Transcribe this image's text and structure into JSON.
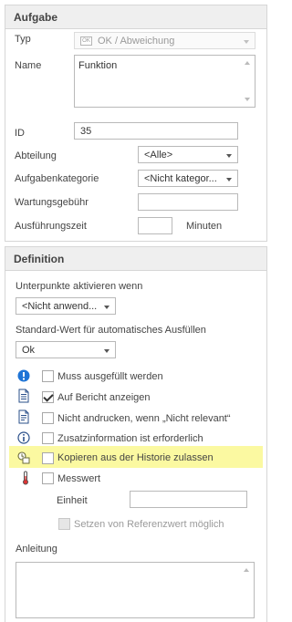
{
  "aufgabe": {
    "header": "Aufgabe",
    "typ_label": "Typ",
    "typ_value": "OK / Abweichung",
    "typ_badge": "OK",
    "name_label": "Name",
    "name_value": "Funktion",
    "id_label": "ID",
    "id_value": "35",
    "abteilung_label": "Abteilung",
    "abteilung_value": "<Alle>",
    "kategorie_label": "Aufgabenkategorie",
    "kategorie_value": "<Nicht kategor...",
    "gebuehr_label": "Wartungsgebühr",
    "gebuehr_value": "",
    "zeit_label": "Ausführungszeit",
    "zeit_value": "",
    "zeit_unit": "Minuten"
  },
  "definition": {
    "header": "Definition",
    "unterpunkte_label": "Unterpunkte aktivieren wenn",
    "unterpunkte_value": "<Nicht anwend...",
    "standard_label": "Standard-Wert für automatisches Ausfüllen",
    "standard_value": "Ok",
    "options": [
      {
        "label": "Muss ausgefüllt werden",
        "checked": false,
        "icon": "required-info-icon"
      },
      {
        "label": "Auf Bericht anzeigen",
        "checked": true,
        "icon": "report-icon"
      },
      {
        "label": "Nicht andrucken, wenn „Nicht relevant“",
        "checked": false,
        "icon": "no-print-icon"
      },
      {
        "label": "Zusatzinformation ist erforderlich",
        "checked": false,
        "icon": "info-icon"
      },
      {
        "label": "Kopieren aus der Historie zulassen",
        "checked": false,
        "icon": "history-copy-icon",
        "highlighted": true
      },
      {
        "label": "Messwert",
        "checked": false,
        "icon": "thermometer-icon"
      }
    ],
    "einheit_label": "Einheit",
    "einheit_value": "",
    "referenz_label": "Setzen von Referenzwert möglich",
    "anleitung_label": "Anleitung",
    "anleitung_value": ""
  },
  "colors": {
    "highlight": "#fbf9a1",
    "info_blue": "#1f74d6",
    "section_header_bg": "#efefef"
  }
}
